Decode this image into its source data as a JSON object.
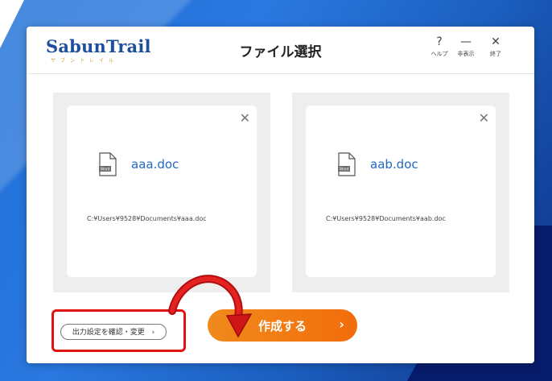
{
  "app": {
    "logo": "SabunTrail",
    "logo_sub": "サブントレイル",
    "title": "ファイル選択"
  },
  "titlebar_buttons": [
    {
      "icon": "help-icon",
      "glyph": "?",
      "label": "ヘルプ"
    },
    {
      "icon": "minimize-icon",
      "glyph": "—",
      "label": "非表示"
    },
    {
      "icon": "close-icon",
      "glyph": "✕",
      "label": "終了"
    }
  ],
  "files": [
    {
      "name": "aaa.doc",
      "path": "C:¥Users¥9528¥Documents¥aaa.doc",
      "icon": "word-doc-icon",
      "badge": "Word",
      "remove": "✕"
    },
    {
      "name": "aab.doc",
      "path": "C:¥Users¥9528¥Documents¥aab.doc",
      "icon": "word-doc-icon",
      "badge": "Word",
      "remove": "✕"
    }
  ],
  "actions": {
    "output_settings": "出力設定を確認・変更",
    "output_settings_chevron": "›",
    "create": "作成する",
    "create_chevron": "›"
  },
  "colors": {
    "accent": "#f26d0b",
    "highlight": "#e11212",
    "brand": "#1d4f9c",
    "background": "#1d6fd6"
  }
}
